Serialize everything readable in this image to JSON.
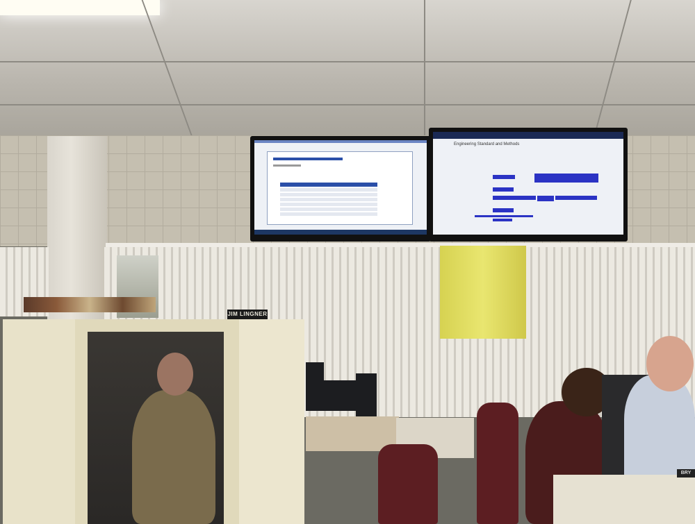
{
  "scene": {
    "nameplate": "JIM LINGNER",
    "nameplate_right": "BRY"
  },
  "left_screen": {
    "app": "web-report"
  },
  "right_screen": {
    "title": "Engineering Standard and Methods"
  },
  "colors": {
    "monitor_bezel": "#111111",
    "gantt_bar": "#2b33c4",
    "taskbar": "#1d3763",
    "cubicle": "#e8e2c9",
    "chair": "#5c1e22"
  }
}
